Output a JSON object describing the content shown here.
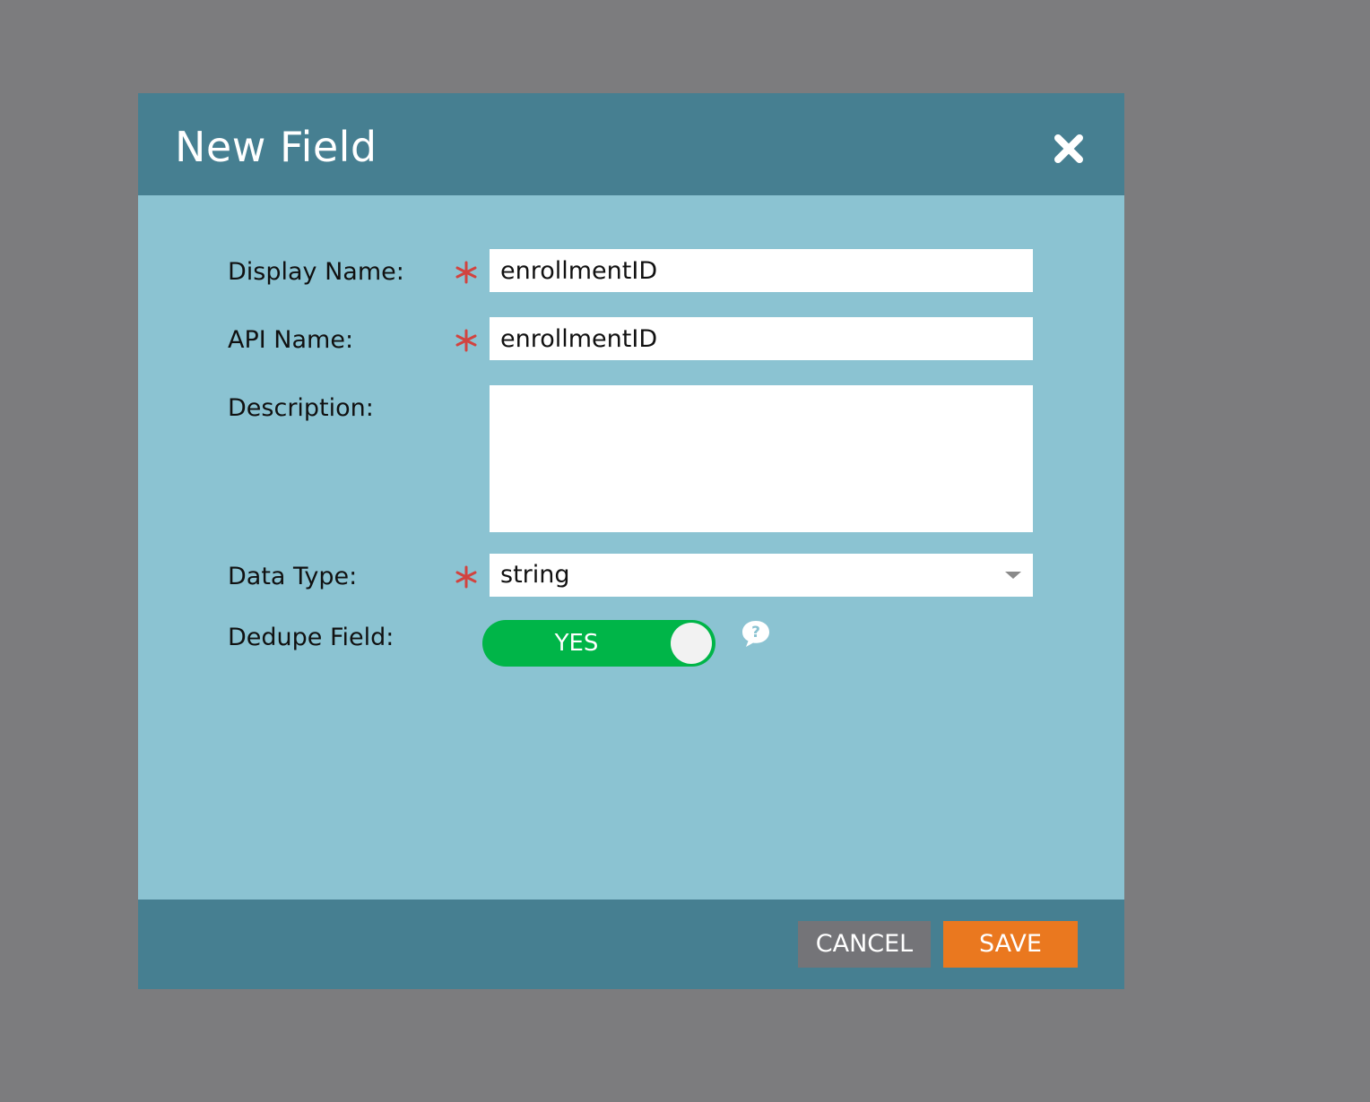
{
  "dialog": {
    "title": "New Field"
  },
  "form": {
    "display_name": {
      "label": "Display Name:",
      "value": "enrollmentID",
      "required": true
    },
    "api_name": {
      "label": "API Name:",
      "value": "enrollmentID",
      "required": true
    },
    "description": {
      "label": "Description:",
      "value": ""
    },
    "data_type": {
      "label": "Data Type:",
      "value": "string",
      "required": true
    },
    "dedupe_field": {
      "label": "Dedupe Field:",
      "toggle_text": "YES",
      "on": true
    }
  },
  "footer": {
    "cancel_label": "CANCEL",
    "save_label": "SAVE"
  },
  "colors": {
    "header": "#467f91",
    "body": "#8bc3d2",
    "required_star": "#d2433f",
    "toggle_on": "#00b548",
    "save": "#ea781f",
    "cancel": "#747478"
  }
}
